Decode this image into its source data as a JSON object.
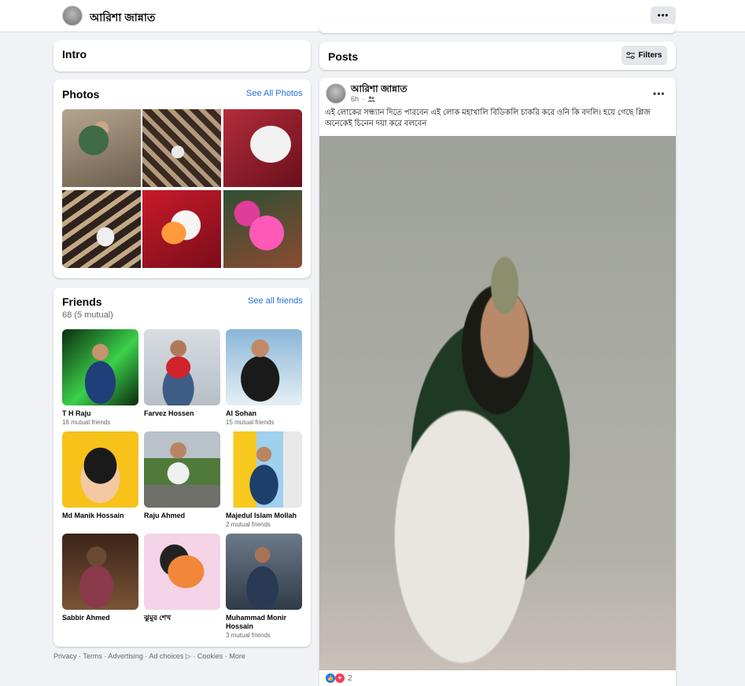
{
  "topbar": {
    "profile_name": "আরিশা জান্নাত",
    "more_label": "•••"
  },
  "intro": {
    "title": "Intro"
  },
  "photos": {
    "title": "Photos",
    "see_all": "See All Photos"
  },
  "friends": {
    "title": "Friends",
    "count": "68 (5 mutual)",
    "see_all": "See all friends",
    "items": [
      {
        "name": "T H Raju",
        "mutual": "16 mutual friends"
      },
      {
        "name": "Farvez Hossen",
        "mutual": ""
      },
      {
        "name": "Al Sohan",
        "mutual": "15 mutual friends"
      },
      {
        "name": "Md Manik Hossain",
        "mutual": ""
      },
      {
        "name": "Raju Ahmed",
        "mutual": ""
      },
      {
        "name": "Majedul Islam Mollah",
        "mutual": "2 mutual friends"
      },
      {
        "name": "Sabbir Ahmed",
        "mutual": ""
      },
      {
        "name": "ঝুমুর শেখ",
        "mutual": ""
      },
      {
        "name": "Muhammad Monir Hossain",
        "mutual": "3 mutual friends"
      }
    ]
  },
  "footer": {
    "text": "Privacy · Terms · Advertising · Ad choices ▷ · Cookies · More"
  },
  "posts": {
    "title": "Posts",
    "filters_label": "Filters",
    "post": {
      "author": "আরিশা জান্নাত",
      "time": "6h",
      "audience_icon": "friends-icon",
      "more_label": "•••",
      "text": "এই লোকের সন্ধ্যান দিতে পারবেন  এই লোক মহাখালি  বিডিকলি চাকরি করে  ওনি কি বদলি। হয়ে গেছে প্লিজ অনেকেই  চিনেন দয়া করে বলবেন",
      "reaction_count": "2"
    }
  },
  "colors": {
    "accent": "#216fdb",
    "background": "#f0f2f5",
    "like": "#1877f2",
    "love": "#f33e58"
  }
}
